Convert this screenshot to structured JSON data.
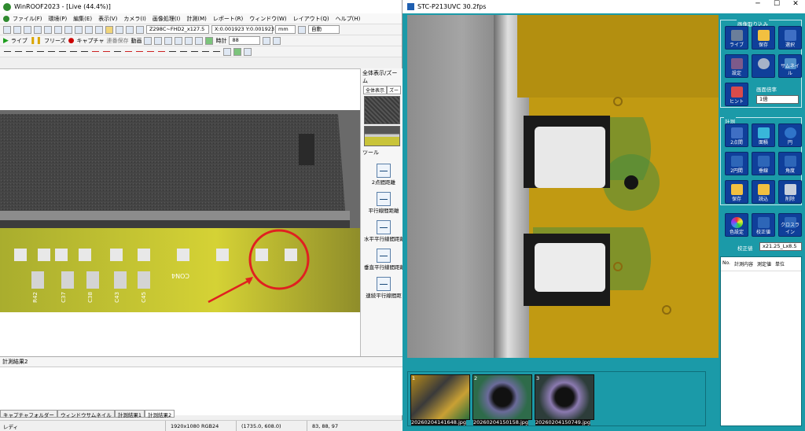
{
  "left": {
    "title": "WinROOF2023 - [Live (44.4%)]",
    "menu": [
      "ファイル(F)",
      "環境(P)",
      "編集(E)",
      "表示(V)",
      "カメラ(I)",
      "画像処理(I)",
      "計測(M)",
      "レポート(R)",
      "ウィンドウ(W)",
      "レイアウト(Q)",
      "ヘルプ(H)"
    ],
    "toolbar1": {
      "camera_select": "Z298C~FHD2_x127.5",
      "coord_readout": "X:0.001923 Y:0.001923",
      "unit": "mm",
      "mode": "自動"
    },
    "toolbar2": {
      "live": "ライブ",
      "freeze": "フリーズ",
      "capture": "キャプチャ",
      "continuous_save": "連番保存",
      "movie": "動画",
      "clock_label": "時計",
      "zoom_value": "88"
    },
    "right_panel": {
      "title": "全体表示/ズーム",
      "tabs": [
        "全体表示",
        "ズー"
      ],
      "tools_header": "ツール",
      "tools": [
        "2点間距離",
        "平行線間距離",
        "水平平行線間距離",
        "垂直平行線間距離",
        "連続平行線間距"
      ]
    },
    "results_header": "計測結果2",
    "bottom_tabs": [
      "キャプチャフォルダー",
      "ウィンドウサムネイル",
      "計測結果1",
      "計測結果2"
    ],
    "status": {
      "state": "レディ",
      "resolution": "1920x1080 RGB24",
      "position": "(1735.0, 608.0)",
      "pixel_value": "83, 88, 97"
    },
    "board_labels": [
      "CON4",
      "R42",
      "C37",
      "C38",
      "C43",
      "C45"
    ]
  },
  "right": {
    "title": "STC-P213UVC 30.2fps",
    "window_controls": [
      "─",
      "☐",
      "✕"
    ],
    "groups": {
      "capture": "画像取り込み",
      "measure": "計測"
    },
    "capture_buttons": [
      "ライブ",
      "保存",
      "選択",
      "設定",
      "",
      "サムネイル",
      "ヒント"
    ],
    "display_ratio_label": "画面倍率",
    "display_ratio_value": "1倍",
    "measure_buttons": [
      "2点間",
      "面積",
      "円",
      "2円間",
      "垂線",
      "角度",
      "保存",
      "読込",
      "削除",
      "色設定",
      "校正値",
      "クロスライン"
    ],
    "calibration_label": "校正値",
    "calibration_value": "x21.25_Lx8.5",
    "table_headers": [
      "No.",
      "計測内容",
      "測定値",
      "単位"
    ],
    "thumbnails": [
      {
        "num": "1",
        "caption": "20260204141648.jpg"
      },
      {
        "num": "2",
        "caption": "20260204150158.jpg"
      },
      {
        "num": "3",
        "caption": "20260204150749.jpg"
      }
    ]
  },
  "colors": {
    "accent_teal": "#1b9aa8",
    "button_blue": "#0f3f9a",
    "annotation_red": "#e02020"
  }
}
